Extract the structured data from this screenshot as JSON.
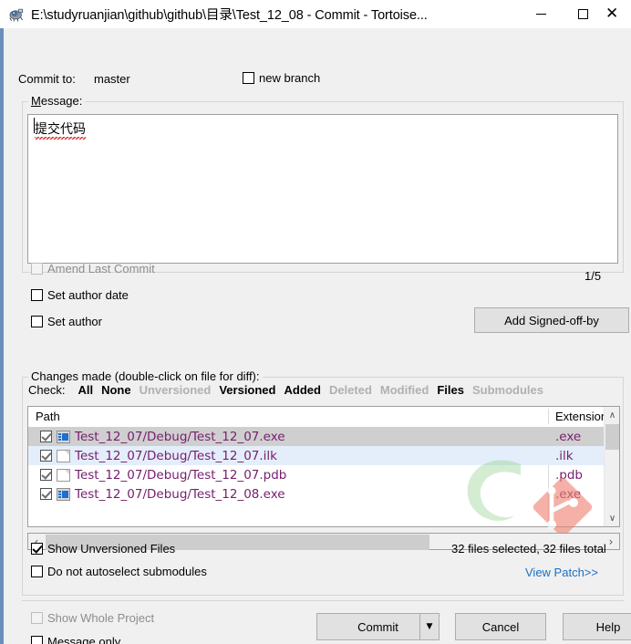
{
  "window": {
    "title": "E:\\studyruanjian\\github\\github\\目录\\Test_12_08 - Commit - Tortoise...",
    "icon": "tortoisegit-turtle-icon",
    "minimize_label": "—",
    "maximize_label": "",
    "close_label": "✕"
  },
  "commit_to": {
    "label": "Commit to:",
    "branch": "master",
    "new_branch_label": "new branch"
  },
  "message": {
    "group_label": "Message:",
    "text": "提交代码",
    "snippet_counter": "1/5"
  },
  "options": {
    "amend_last_commit": "Amend Last Commit",
    "set_author_date": "Set author date",
    "set_author": "Set author",
    "add_signed_off_by": "Add Signed-off-by"
  },
  "changes": {
    "group_label": "Changes made (double-click on file for diff):",
    "check_label": "Check:",
    "check_links": [
      {
        "label": "All",
        "enabled": true
      },
      {
        "label": "None",
        "enabled": true
      },
      {
        "label": "Unversioned",
        "enabled": false
      },
      {
        "label": "Versioned",
        "enabled": true
      },
      {
        "label": "Added",
        "enabled": true
      },
      {
        "label": "Deleted",
        "enabled": false
      },
      {
        "label": "Modified",
        "enabled": false
      },
      {
        "label": "Files",
        "enabled": true
      },
      {
        "label": "Submodules",
        "enabled": false
      }
    ],
    "columns": [
      "Path",
      "Extension"
    ],
    "rows": [
      {
        "checked": true,
        "icon": "exe-file-icon",
        "path": "Test_12_07/Debug/Test_12_07.exe",
        "extension": ".exe",
        "state": "selected"
      },
      {
        "checked": true,
        "icon": "document-file-icon",
        "path": "Test_12_07/Debug/Test_12_07.ilk",
        "extension": ".ilk",
        "state": "focused"
      },
      {
        "checked": true,
        "icon": "document-file-icon",
        "path": "Test_12_07/Debug/Test_12_07.pdb",
        "extension": ".pdb",
        "state": "normal"
      },
      {
        "checked": true,
        "icon": "exe-file-icon",
        "path": "Test_12_07/Debug/Test_12_08.exe",
        "extension": ".exe",
        "state": "normal"
      }
    ],
    "show_unversioned_files": "Show Unversioned Files",
    "do_not_autoselect_submodules": "Do not autoselect submodules",
    "status_text": "32 files selected, 32 files total",
    "view_patch_link": "View Patch>>"
  },
  "footer": {
    "show_whole_project": "Show Whole Project",
    "message_only": "Message only",
    "commit_button": "Commit",
    "commit_dropdown_glyph": "▼",
    "cancel_button": "Cancel",
    "help_button": "Help"
  },
  "scrollbars": {
    "up_glyph": "∧",
    "down_glyph": "∨",
    "left_glyph": "‹",
    "right_glyph": "›"
  },
  "colors": {
    "window_border": "#6a8fbb",
    "dialog_bg": "#f0f0f0",
    "unversioned_file": "#77206e",
    "link": "#1b6fc4",
    "selection": "#cfcfcf",
    "focus_row": "#e4eefb",
    "watermark_git": "#ef8374",
    "watermark_green": "#8ed38a"
  }
}
